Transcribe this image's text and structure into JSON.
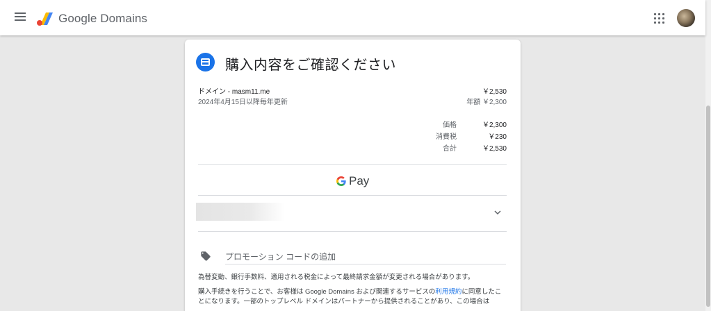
{
  "app": {
    "brand": "Google Domains"
  },
  "checkout": {
    "title": "購入内容をご確認ください",
    "item_name": "ドメイン - masm11.me",
    "item_price": "￥2,530",
    "renewal_text": "2024年4月15日以降毎年更新",
    "annual_price": "年額 ￥2,300",
    "summary": [
      {
        "label": "価格",
        "value": "￥2,300"
      },
      {
        "label": "消費税",
        "value": "￥230"
      },
      {
        "label": "合計",
        "value": "￥2,530"
      }
    ],
    "gpay_label": "Pay",
    "promo_placeholder": "プロモーション コードの追加",
    "note_fx": "為替変動、銀行手数料、適用される税金によって最終請求金額が変更される場合があります。",
    "note_terms_before": "購入手続きを行うことで、お客様は Google Domains および関連するサービスの",
    "note_terms_link": "利用規約",
    "note_terms_after": "に同意したことになります。一部のトップレベル ドメインはパートナーから提供されることがあり、この場合は"
  },
  "icons": {
    "menu": "menu-icon",
    "logo": "google-domains-logo",
    "apps": "apps-grid-icon",
    "payment": "credit-card-icon",
    "promo": "tag-icon",
    "expand": "chevron-down-icon"
  },
  "colors": {
    "accent": "#1a73e8",
    "background": "#e8e8e8"
  }
}
